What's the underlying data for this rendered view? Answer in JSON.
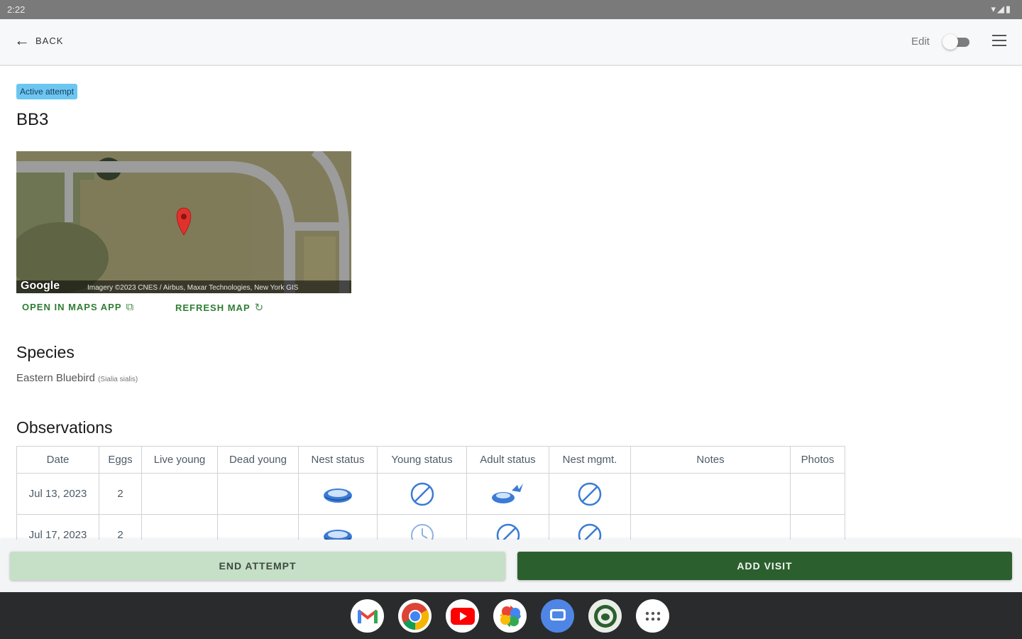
{
  "status_bar": {
    "time": "2:22",
    "icons": "▾◢▮"
  },
  "app_bar": {
    "back_label": "BACK",
    "edit_label": "Edit",
    "edit_toggle_on": false
  },
  "nest": {
    "status_badge": "Active attempt",
    "name": "BB3"
  },
  "map": {
    "provider": "Google",
    "attribution": "Imagery ©2023 CNES / Airbus, Maxar Technologies, New York GIS",
    "open_label": "OPEN IN MAPS APP",
    "refresh_label": "REFRESH MAP"
  },
  "species": {
    "heading": "Species",
    "common_name": "Eastern Bluebird",
    "scientific_name": "(Sialia sialis)"
  },
  "observations": {
    "heading": "Observations",
    "columns": [
      "Date",
      "Eggs",
      "Live young",
      "Dead young",
      "Nest status",
      "Young status",
      "Adult status",
      "Nest mgmt.",
      "Notes",
      "Photos"
    ],
    "rows": [
      {
        "date": "Jul 13, 2023",
        "eggs": "2",
        "live_young": "",
        "dead_young": "",
        "nest_status": "nest-icon",
        "young_status": "none-icon",
        "adult_status": "adult-departing-icon",
        "nest_mgmt": "none-icon",
        "notes": "",
        "photos": ""
      },
      {
        "date": "Jul 17, 2023",
        "eggs": "2",
        "live_young": "",
        "dead_young": "",
        "nest_status": "nest-icon",
        "young_status": "clock-icon",
        "adult_status": "none-icon",
        "nest_mgmt": "none-icon",
        "notes": "",
        "photos": ""
      }
    ]
  },
  "actions": {
    "end_label": "END ATTEMPT",
    "add_label": "ADD VISIT"
  },
  "colors": {
    "primary": "#2c5f2e",
    "primary_light": "#c6dfc7",
    "badge": "#6cc6f2",
    "icon_blue": "#3a7bd5"
  },
  "dock_apps": [
    "gmail-icon",
    "chrome-icon",
    "youtube-icon",
    "photos-icon",
    "messages-icon",
    "nestwatch-icon",
    "app-drawer-icon"
  ]
}
